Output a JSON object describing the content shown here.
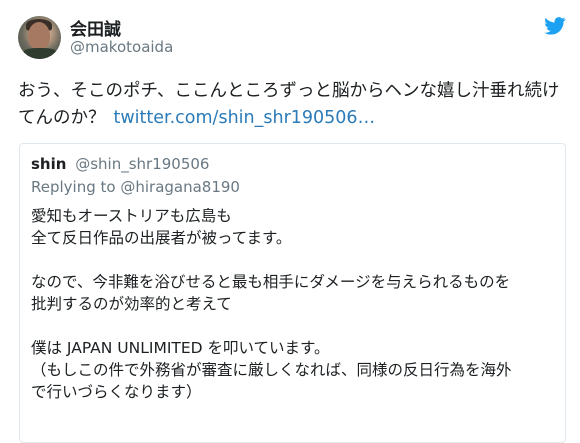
{
  "tweet": {
    "author": {
      "display_name": "会田誠",
      "handle": "@makotoaida"
    },
    "text": "おう、そこのポチ、ここんところずっと脳からヘンな嬉し汁垂れ続けてんのか？",
    "link_text": "twitter.com/shin_shr190506…",
    "icon": "twitter-bird-icon",
    "colors": {
      "link": "#2b7bb9",
      "brand": "#1da1f2",
      "muted": "#697882",
      "text": "#1c2022",
      "border": "#e1e8ed"
    }
  },
  "quoted_tweet": {
    "author": {
      "display_name": "shin",
      "handle": "@shin_shr190506"
    },
    "replying_to_label": "Replying to",
    "replying_to_handle": "@hiragana8190",
    "paragraphs": [
      [
        "愛知もオーストリアも広島も",
        "全て反日作品の出展者が被ってます。"
      ],
      [
        "なので、今非難を浴びせると最も相手にダメージを与えられるものを",
        "批判するのが効率的と考えて"
      ],
      [
        "僕は JAPAN UNLIMITED を叩いています。",
        "（もしこの件で外務省が審査に厳しくなれば、同様の反日行為を海外",
        "で行いづらくなります）"
      ]
    ]
  }
}
